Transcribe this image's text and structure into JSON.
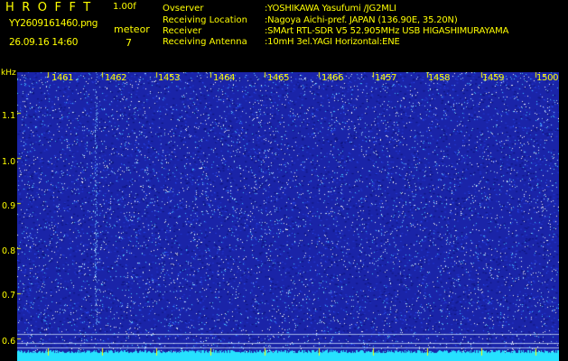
{
  "header": {
    "app_title": "HROFFT",
    "version": "1.00f",
    "filename": "YY2609161460.png",
    "datetime": "26.09.16 14:60",
    "meteor_label": "meteor",
    "meteor_count": "7",
    "info": [
      {
        "key": "Ovserver",
        "value": ":YOSHIKAWA Yasufumi /JG2MLI"
      },
      {
        "key": "Receiving Location",
        "value": ":Nagoya Aichi-pref. JAPAN (136.90E, 35.20N)"
      },
      {
        "key": "Receiver",
        "value": ":SMArt RTL-SDR V5 52.905MHz USB HIGASHIMURAYAMA"
      },
      {
        "key": "Receiving Antenna",
        "value": ":10mH 3el.YAGI Horizontal:ENE"
      }
    ]
  },
  "spectrogram": {
    "unit": "kHz",
    "y_ticks": [
      "1.1",
      "1.0",
      "0.9",
      "0.8",
      "0.7",
      "0.6"
    ],
    "x_ticks": [
      "1461",
      "1462",
      "1453",
      "1464",
      "1465",
      "1466",
      "1457",
      "1458",
      "1459",
      "1500"
    ],
    "y_range_khz": [
      0.57,
      1.15
    ],
    "noise_color": "#1a24a8",
    "speck_colors": [
      "#ffffff",
      "#9fd8ff",
      "#45c8ff",
      "#2a56ff"
    ],
    "bottom_band_color": "#26e1ff",
    "tick_color": "#ffff00"
  }
}
